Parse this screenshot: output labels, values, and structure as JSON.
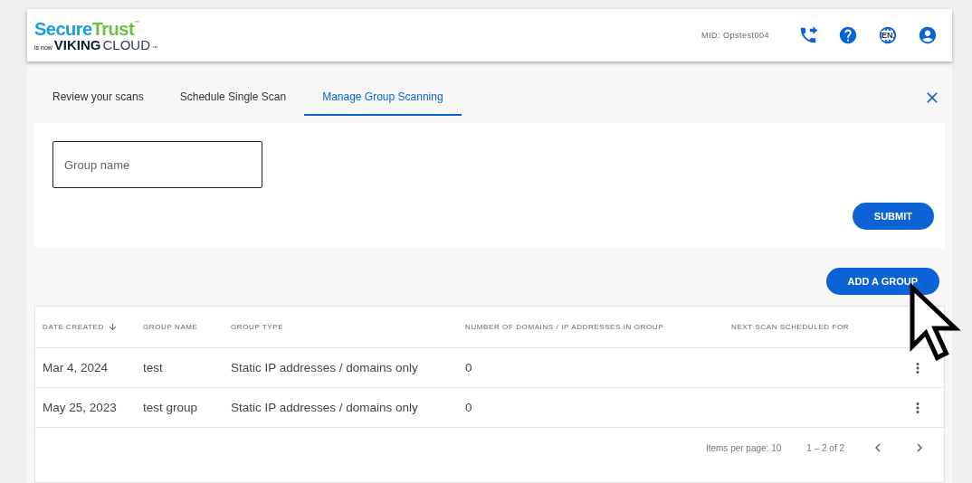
{
  "header": {
    "logo": {
      "secure": "Secure",
      "trust": "Trust",
      "tm": "™",
      "is_now": "is now",
      "viking": "VIKING",
      "cloud": "CLOUD",
      "tm2": "™"
    },
    "mid": "MID: Opstest004",
    "language": "EN"
  },
  "tabs": [
    {
      "label": "Review your scans",
      "selected": false
    },
    {
      "label": "Schedule Single Scan",
      "selected": false
    },
    {
      "label": "Manage Group Scanning",
      "selected": true
    }
  ],
  "form": {
    "group_name": {
      "placeholder": "Group name"
    },
    "submit": "SUBMIT"
  },
  "add_group": "ADD A GROUP",
  "table": {
    "columns": [
      {
        "label": "DATE CREATED",
        "sorted": true
      },
      {
        "label": "GROUP NAME",
        "sorted": false
      },
      {
        "label": "GROUP TYPE",
        "sorted": false
      },
      {
        "label": "NUMBER OF DOMAINS / IP ADDRESSES IN GROUP",
        "sorted": false
      },
      {
        "label": "NEXT SCAN SCHEDULED FOR",
        "sorted": false
      }
    ],
    "rows": [
      {
        "cells": [
          "Mar 4, 2024",
          "test",
          "Static IP addresses / domains only",
          "0",
          ""
        ]
      },
      {
        "cells": [
          "May 25, 2023",
          "test group",
          "Static IP addresses / domains only",
          "0",
          ""
        ]
      }
    ]
  },
  "paginator": {
    "items_per_page": "Items per page: 10",
    "range": "1 – 2 of 2"
  }
}
